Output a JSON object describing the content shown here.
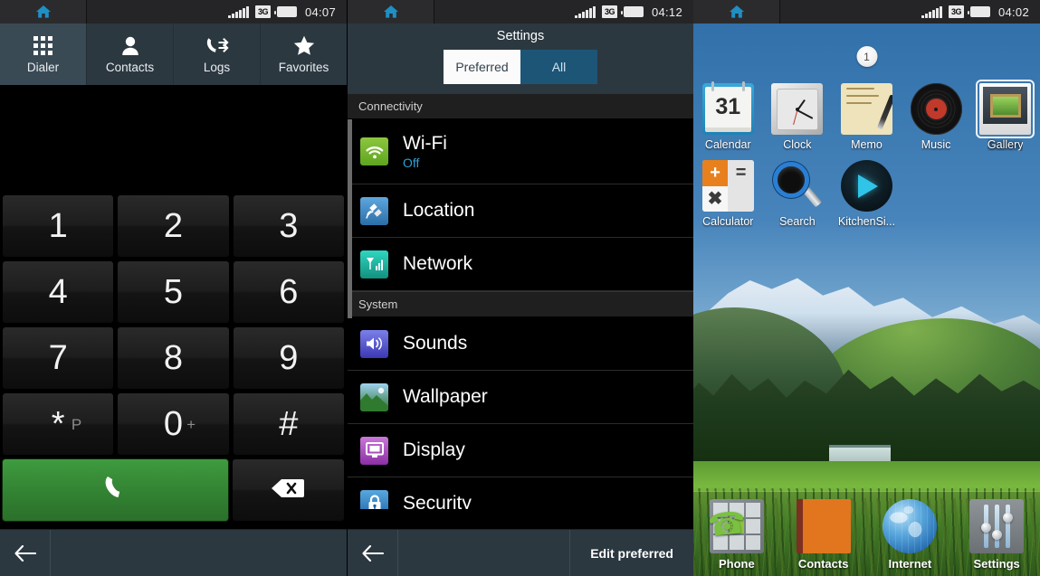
{
  "panels": {
    "dialer": {
      "status": {
        "time": "04:07",
        "network": "3G",
        "home_icon": "home-icon"
      },
      "tabs": [
        {
          "label": "Dialer",
          "icon": "grid-dots-icon",
          "active": true
        },
        {
          "label": "Contacts",
          "icon": "person-icon",
          "active": false
        },
        {
          "label": "Logs",
          "icon": "call-log-icon",
          "active": false
        },
        {
          "label": "Favorites",
          "icon": "star-icon",
          "active": false
        }
      ],
      "keys": [
        {
          "main": "1",
          "sub": ""
        },
        {
          "main": "2",
          "sub": ""
        },
        {
          "main": "3",
          "sub": ""
        },
        {
          "main": "4",
          "sub": ""
        },
        {
          "main": "5",
          "sub": ""
        },
        {
          "main": "6",
          "sub": ""
        },
        {
          "main": "7",
          "sub": ""
        },
        {
          "main": "8",
          "sub": ""
        },
        {
          "main": "9",
          "sub": ""
        },
        {
          "main": "*",
          "sub": "P"
        },
        {
          "main": "0",
          "sub": "+"
        },
        {
          "main": "#",
          "sub": ""
        }
      ],
      "call_button": "call-icon",
      "delete_button": "backspace-icon",
      "footer": {
        "back": "back-arrow-icon"
      }
    },
    "settings": {
      "status": {
        "time": "04:12",
        "network": "3G",
        "home_icon": "home-icon"
      },
      "title": "Settings",
      "segments": [
        {
          "label": "Preferred",
          "selected": true
        },
        {
          "label": "All",
          "selected": false
        }
      ],
      "sections": [
        {
          "header": "Connectivity",
          "rows": [
            {
              "name": "Wi-Fi",
              "value": "Off",
              "icon": "wifi-icon"
            },
            {
              "name": "Location",
              "value": "",
              "icon": "satellite-icon"
            },
            {
              "name": "Network",
              "value": "",
              "icon": "signal-icon"
            }
          ]
        },
        {
          "header": "System",
          "rows": [
            {
              "name": "Sounds",
              "value": "",
              "icon": "speaker-icon"
            },
            {
              "name": "Wallpaper",
              "value": "",
              "icon": "landscape-icon"
            },
            {
              "name": "Display",
              "value": "",
              "icon": "monitor-icon"
            },
            {
              "name": "Security",
              "value": "",
              "icon": "lock-icon"
            }
          ]
        }
      ],
      "footer": {
        "back": "back-arrow-icon",
        "action": "Edit preferred"
      }
    },
    "home": {
      "status": {
        "time": "04:02",
        "network": "3G",
        "home_icon": "home-icon"
      },
      "page_indicator": "1",
      "apps": [
        {
          "label": "Calendar",
          "icon": "calendar-icon",
          "badge": "31",
          "selected": false
        },
        {
          "label": "Clock",
          "icon": "clock-icon",
          "selected": false
        },
        {
          "label": "Memo",
          "icon": "memo-icon",
          "selected": false
        },
        {
          "label": "Music",
          "icon": "music-icon",
          "selected": false
        },
        {
          "label": "Gallery",
          "icon": "gallery-icon",
          "selected": true
        },
        {
          "label": "Calculator",
          "icon": "calculator-icon",
          "selected": false
        },
        {
          "label": "Search",
          "icon": "search-icon",
          "selected": false
        },
        {
          "label": "KitchenSi...",
          "icon": "kitchensink-icon",
          "selected": false
        }
      ],
      "calculator_glyphs": {
        "plus": "+",
        "equals": "=",
        "multiply": "✖"
      },
      "dock": [
        {
          "label": "Phone",
          "icon": "phone-icon"
        },
        {
          "label": "Contacts",
          "icon": "contacts-icon"
        },
        {
          "label": "Internet",
          "icon": "globe-icon"
        },
        {
          "label": "Settings",
          "icon": "sliders-icon"
        }
      ]
    }
  },
  "colors": {
    "accent_blue": "#2e9fd8",
    "chrome": "#2c3840",
    "call_green": "#3f9b3f",
    "selected_tab": "#fbfbfb",
    "segment_blue": "#1d5577"
  }
}
